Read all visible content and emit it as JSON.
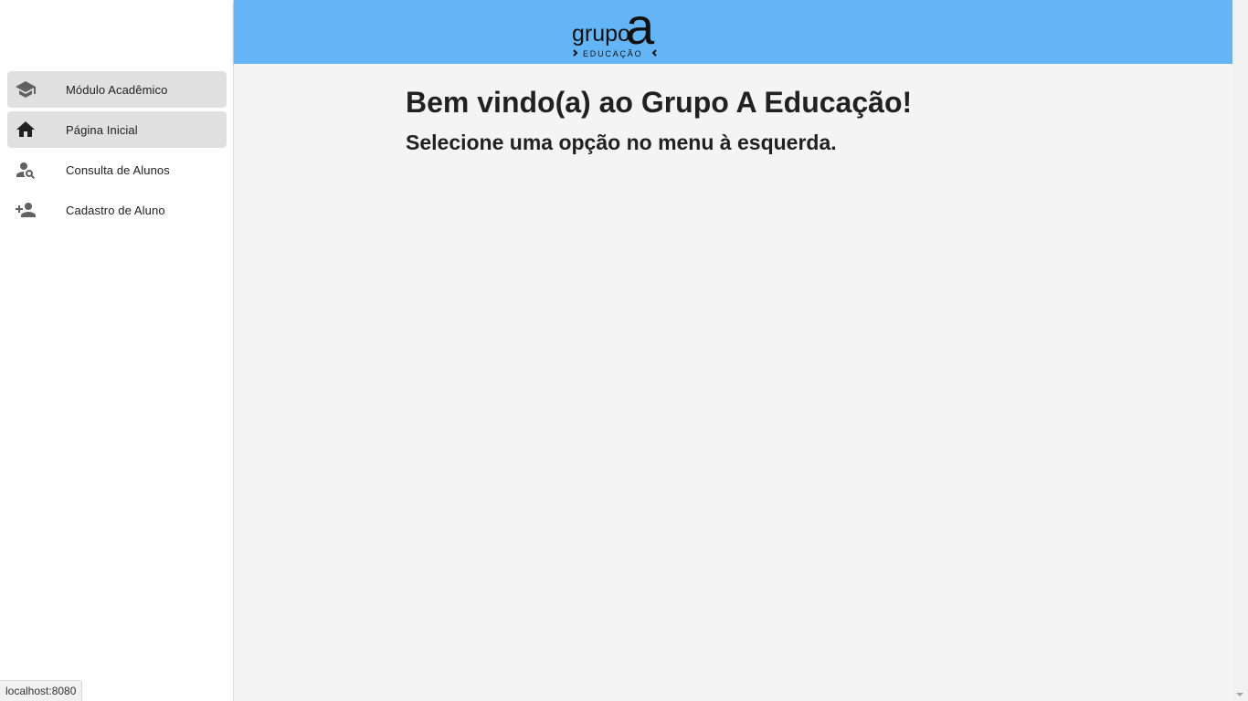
{
  "sidebar": {
    "items": [
      {
        "label": "Módulo Acadêmico",
        "icon": "graduation-cap-icon",
        "active": true
      },
      {
        "label": "Página Inicial",
        "icon": "home-icon",
        "active": true
      },
      {
        "label": "Consulta de Alunos",
        "icon": "person-search-icon",
        "active": false
      },
      {
        "label": "Cadastro de Aluno",
        "icon": "person-add-icon",
        "active": false
      }
    ]
  },
  "header": {
    "logo_text_top": "grupo",
    "logo_letter": "a",
    "logo_text_bottom": "EDUCAÇÃO",
    "background_color": "#64b5f6"
  },
  "main": {
    "title": "Bem vindo(a) ao Grupo A Educação!",
    "subtitle": "Selecione uma opção no menu à esquerda."
  },
  "status_bar": {
    "url": "localhost:8080"
  }
}
